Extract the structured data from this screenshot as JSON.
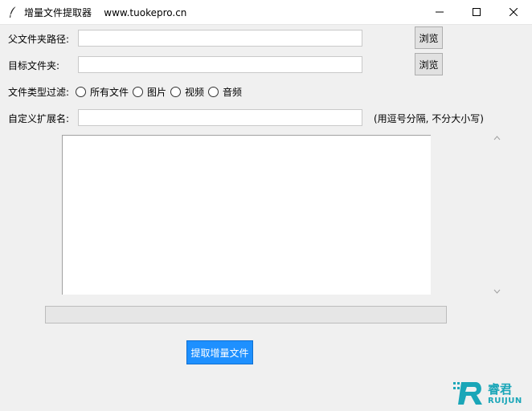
{
  "window": {
    "title": "增量文件提取器    www.tuokepro.cn",
    "controls": {
      "minimize": "minimize-icon",
      "maximize": "maximize-icon",
      "close": "close-icon"
    }
  },
  "form": {
    "parent_folder_label": "父文件夹路径:",
    "parent_folder_value": "",
    "target_folder_label": "目标文件夹:",
    "target_folder_value": "",
    "browse_label": "浏览",
    "file_type_label": "文件类型过滤:",
    "file_types": [
      "所有文件",
      "图片",
      "视频",
      "音频"
    ],
    "custom_ext_label": "自定义扩展名:",
    "custom_ext_value": "",
    "custom_ext_hint": "(用逗号分隔, 不分大小写)"
  },
  "log": {
    "text": ""
  },
  "progress": {
    "value": 0
  },
  "actions": {
    "extract_label": "提取增量文件"
  },
  "logo": {
    "cn": "睿君",
    "en": "RUIJUN",
    "color": "#1aa6b8"
  },
  "colors": {
    "accent": "#1e90ff",
    "background": "#f0f0f0"
  }
}
